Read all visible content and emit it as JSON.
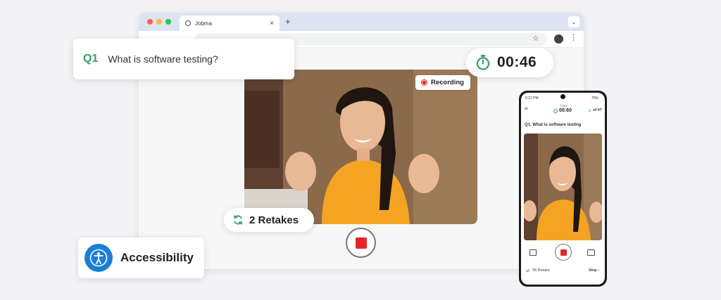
{
  "browser": {
    "tab_title": "Jobma",
    "tab_close": "×",
    "new_tab": "+",
    "tab_dropdown": "⌄",
    "star": "☆",
    "menu": "⋮"
  },
  "question": {
    "number": "Q1",
    "text": "What is software testing?"
  },
  "timer": {
    "time": "00:46"
  },
  "recording": {
    "label": "Recording"
  },
  "retakes": {
    "label": "2 Retakes"
  },
  "accessibility": {
    "label": "Accessibility"
  },
  "phone": {
    "status_time": "5:12 PM",
    "status_right": "70%",
    "timer_caption": "Timer",
    "timer_value": "00:60",
    "question_count": "of 07",
    "question": "Q1. What is software testing",
    "retake": "05 Retake",
    "skip": "Skip ›"
  },
  "colors": {
    "accent_green": "#2fa35f",
    "record_red": "#e5262b",
    "accessibility_blue": "#1b7ed6"
  }
}
